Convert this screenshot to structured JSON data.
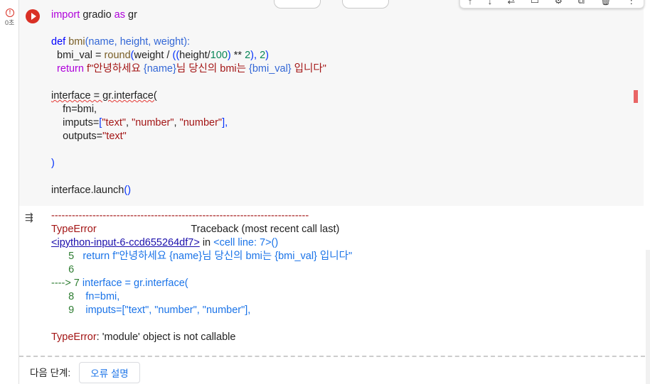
{
  "exec": {
    "status_icon": "error-icon",
    "time": "0초"
  },
  "code_lines": [
    [
      {
        "t": "import",
        "c": "kw"
      },
      {
        "t": " gradio ",
        "c": ""
      },
      {
        "t": "as",
        "c": "kw"
      },
      {
        "t": " gr",
        "c": ""
      }
    ],
    [],
    [
      {
        "t": "def",
        "c": "def"
      },
      {
        "t": " ",
        "c": ""
      },
      {
        "t": "bmi",
        "c": "fn"
      },
      {
        "t": "(name, height, weight):",
        "c": "blue"
      }
    ],
    [
      {
        "t": "  bmi_val = ",
        "c": ""
      },
      {
        "t": "round",
        "c": "fn"
      },
      {
        "t": "(",
        "c": "paren"
      },
      {
        "t": "weight / ",
        "c": ""
      },
      {
        "t": "((",
        "c": "paren"
      },
      {
        "t": "height/",
        "c": ""
      },
      {
        "t": "100",
        "c": "num"
      },
      {
        "t": ")",
        "c": "paren"
      },
      {
        "t": " ** ",
        "c": ""
      },
      {
        "t": "2",
        "c": "num"
      },
      {
        "t": "), ",
        "c": "paren"
      },
      {
        "t": "2",
        "c": "num"
      },
      {
        "t": ")",
        "c": "paren"
      }
    ],
    [
      {
        "t": "  return",
        "c": "kw"
      },
      {
        "t": " f\"안녕하세요 ",
        "c": "str"
      },
      {
        "t": "{name}",
        "c": "blue"
      },
      {
        "t": "님 당신의 bmi는 ",
        "c": "str"
      },
      {
        "t": "{bmi_val}",
        "c": "blue"
      },
      {
        "t": " 입니다\"",
        "c": "str"
      }
    ],
    [],
    [
      {
        "t": "interface = gr.interface(",
        "c": "squiggle"
      }
    ],
    [
      {
        "t": "    fn=bmi,",
        "c": ""
      }
    ],
    [
      {
        "t": "    imputs=",
        "c": ""
      },
      {
        "t": "[",
        "c": "paren"
      },
      {
        "t": "\"text\"",
        "c": "str"
      },
      {
        "t": ", ",
        "c": ""
      },
      {
        "t": "\"number\"",
        "c": "str"
      },
      {
        "t": ", ",
        "c": ""
      },
      {
        "t": "\"number\"",
        "c": "str"
      },
      {
        "t": "],",
        "c": "paren"
      }
    ],
    [
      {
        "t": "    outputs=",
        "c": ""
      },
      {
        "t": "\"text\"",
        "c": "str"
      }
    ],
    [],
    [
      {
        "t": ")",
        "c": "paren"
      }
    ],
    [],
    [
      {
        "t": "interface.launch",
        "c": ""
      },
      {
        "t": "()",
        "c": "paren"
      }
    ]
  ],
  "output_lines": [
    [
      {
        "t": "---------------------------------------------------------------------------",
        "c": "err"
      }
    ],
    [
      {
        "t": "TypeError",
        "c": "err"
      },
      {
        "t": "                                 Traceback (most recent call last)",
        "c": ""
      }
    ],
    [
      {
        "t": "<ipython-input-6-ccd655264df7>",
        "c": "link"
      },
      {
        "t": " in ",
        "c": ""
      },
      {
        "t": "<cell line: 7>()",
        "c": "lnk2"
      }
    ],
    [
      {
        "t": "      5 ",
        "c": "green"
      },
      {
        "t": "  return f\"안녕하세요 {name}님 당신의 bmi는 {bmi_val} 입니다\"",
        "c": "lnk2"
      }
    ],
    [
      {
        "t": "      6",
        "c": "green"
      }
    ],
    [
      {
        "t": "----> 7 ",
        "c": "green"
      },
      {
        "t": "interface = gr.interface(",
        "c": "lnk2"
      }
    ],
    [
      {
        "t": "      8 ",
        "c": "green"
      },
      {
        "t": "   fn=bmi,",
        "c": "lnk2"
      }
    ],
    [
      {
        "t": "      9 ",
        "c": "green"
      },
      {
        "t": "   imputs=[\"text\", \"number\", \"number\"],",
        "c": "lnk2"
      }
    ],
    [],
    [
      {
        "t": "TypeError",
        "c": "err"
      },
      {
        "t": ": 'module' object is not callable",
        "c": ""
      }
    ]
  ],
  "next_step": {
    "label": "다음 단계:",
    "button": "오류 설명"
  },
  "toolbar_icons": [
    "arrow-up-icon",
    "arrow-down-icon",
    "link-icon",
    "comment-icon",
    "gear-icon",
    "mirror-icon",
    "delete-icon",
    "more-icon"
  ],
  "toolbar_glyphs": [
    "↑",
    "↓",
    "⇄",
    "▭",
    "⚙",
    "⧉",
    "🗑",
    "⋮"
  ]
}
